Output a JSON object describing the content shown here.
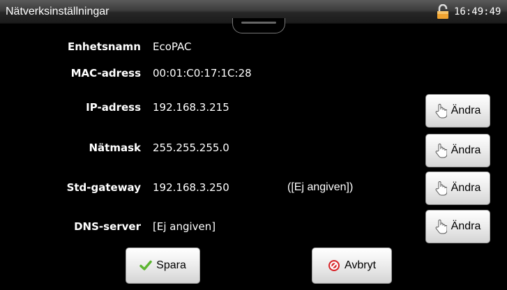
{
  "titlebar": {
    "title": "Nätverksinställningar",
    "time": "16:49:49",
    "lock_icon": "unlocked-padlock-icon"
  },
  "fields": {
    "device_name": {
      "label": "Enhetsnamn",
      "value": "EcoPAC"
    },
    "mac": {
      "label": "MAC-adress",
      "value": "00:01:C0:17:1C:28"
    },
    "ip": {
      "label": "IP-adress",
      "value": "192.168.3.215",
      "button": "Ändra"
    },
    "netmask": {
      "label": "Nätmask",
      "value": "255.255.255.0",
      "button": "Ändra"
    },
    "gateway": {
      "label": "Std-gateway",
      "value": "192.168.3.250",
      "note": "([Ej angiven])",
      "button": "Ändra"
    },
    "dns": {
      "label": "DNS-server",
      "value": "[Ej angiven]",
      "button": "Ändra"
    }
  },
  "actions": {
    "save_label": "Spara",
    "cancel_label": "Avbryt"
  },
  "colors": {
    "background": "#000000",
    "check_green": "#5cb531",
    "cancel_red": "#d8262b",
    "lock_orange": "#f0a330"
  }
}
